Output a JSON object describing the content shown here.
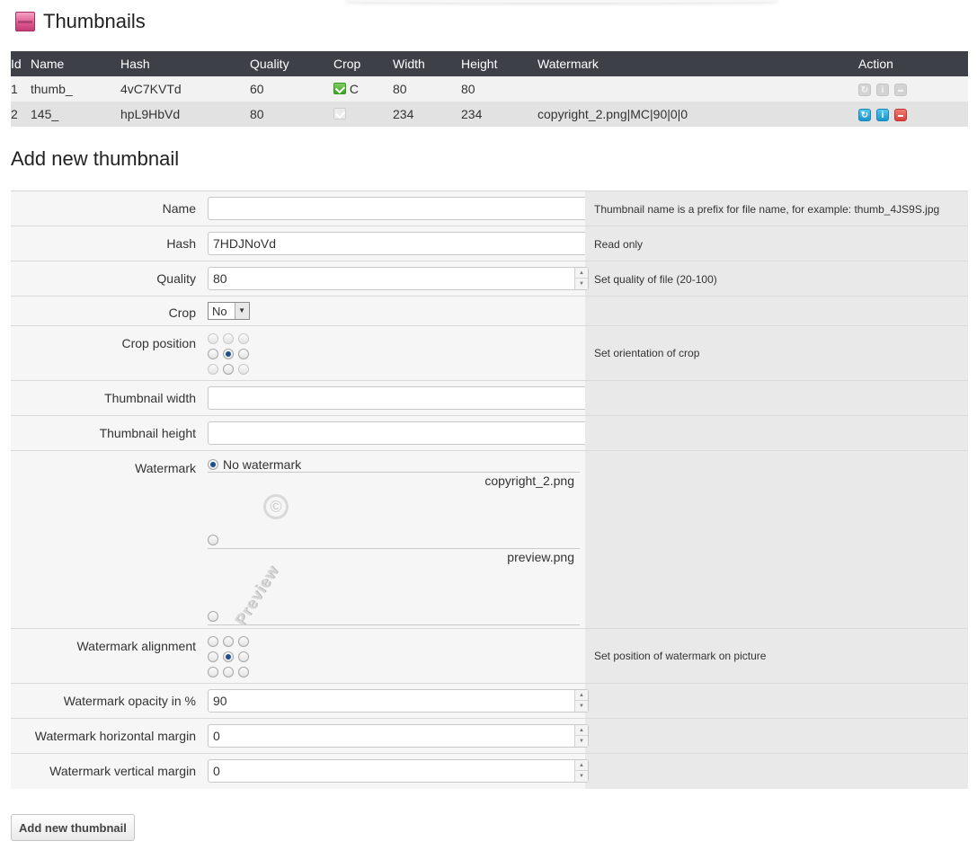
{
  "header": {
    "title": "Thumbnails",
    "icon": "thumbnail-app-icon"
  },
  "table": {
    "columns": [
      "Id",
      "Name",
      "Hash",
      "Quality",
      "Crop",
      "Width",
      "Height",
      "Watermark",
      "Action"
    ],
    "rows": [
      {
        "id": "1",
        "name": "thumb_",
        "hash": "4vC7KVTd",
        "quality": "60",
        "crop": true,
        "crop_label": "C",
        "width": "80",
        "height": "80",
        "watermark": "",
        "actions_enabled": false
      },
      {
        "id": "2",
        "name": "145_",
        "hash": "hpL9HbVd",
        "quality": "80",
        "crop": false,
        "crop_label": "",
        "width": "234",
        "height": "234",
        "watermark": "copyright_2.png|MC|90|0|0",
        "actions_enabled": true
      }
    ]
  },
  "form": {
    "title": "Add new thumbnail",
    "name": {
      "label": "Name",
      "value": "",
      "hint": "Thumbnail name is a prefix for file name, for example: thumb_4JS9S.jpg"
    },
    "hash": {
      "label": "Hash",
      "value": "7HDJNoVd",
      "hint": "Read only"
    },
    "quality": {
      "label": "Quality",
      "value": "80",
      "hint": "Set quality of file (20-100)"
    },
    "crop": {
      "label": "Crop",
      "value": "No"
    },
    "crop_position": {
      "label": "Crop position",
      "hint": "Set orientation of crop",
      "selected": "center"
    },
    "width": {
      "label": "Thumbnail width",
      "value": ""
    },
    "height": {
      "label": "Thumbnail height",
      "value": ""
    },
    "watermark": {
      "label": "Watermark",
      "none_label": "No watermark",
      "options": [
        "copyright_2.png",
        "preview.png"
      ],
      "preview_text": "Preview",
      "copyright_symbol": "©"
    },
    "watermark_alignment": {
      "label": "Watermark alignment",
      "hint": "Set position of watermark on picture",
      "selected": "center"
    },
    "opacity": {
      "label": "Watermark opacity in %",
      "value": "90"
    },
    "h_margin": {
      "label": "Watermark horizontal margin",
      "value": "0"
    },
    "v_margin": {
      "label": "Watermark vertical margin",
      "value": "0"
    },
    "submit_label": "Add new thumbnail"
  },
  "colors": {
    "header_bg": "#3d4047",
    "row_odd": "#f2f2f2",
    "row_even": "#e2e2e2",
    "accent_blue": "#1a95cd",
    "accent_red": "#d9413a",
    "check_green": "#3aa120"
  }
}
